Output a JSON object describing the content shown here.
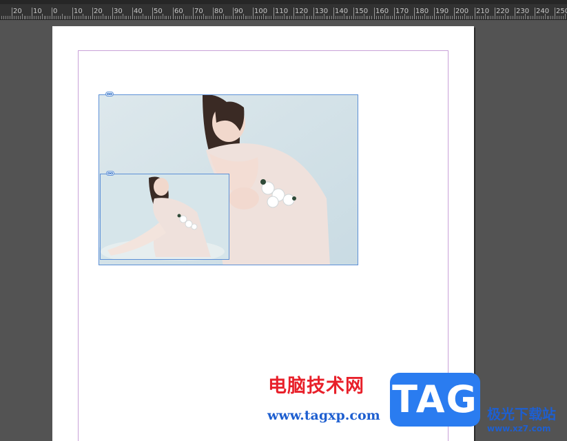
{
  "ruler": {
    "labels": [
      "20",
      "10",
      "0",
      "10",
      "20",
      "30",
      "40",
      "50",
      "60",
      "70",
      "80",
      "90",
      "100",
      "110",
      "120",
      "130",
      "140",
      "150",
      "160",
      "170",
      "180",
      "190",
      "200",
      "210",
      "220",
      "230",
      "240",
      "250"
    ]
  },
  "document": {
    "frames": [
      {
        "name": "large-image-frame",
        "content": "photo of woman in white dress sitting with flowers"
      },
      {
        "name": "small-image-frame",
        "content": "photo of woman in white dress sitting with flowers"
      }
    ]
  },
  "watermark": {
    "cn_text": "电脑技术网",
    "url_text": "www.tagxp.com",
    "logo_text": "TAG",
    "site_cn": "极光下载站",
    "site_url": "www.xz7.com"
  },
  "colors": {
    "pasteboard": "#535353",
    "ruler": "#323232",
    "frame_border": "#5b8fd6",
    "margin_guide": "#c8a0d8",
    "watermark_red": "#e8202a",
    "watermark_blue": "#1e5fd0",
    "logo_blue": "#2a7cf0"
  }
}
